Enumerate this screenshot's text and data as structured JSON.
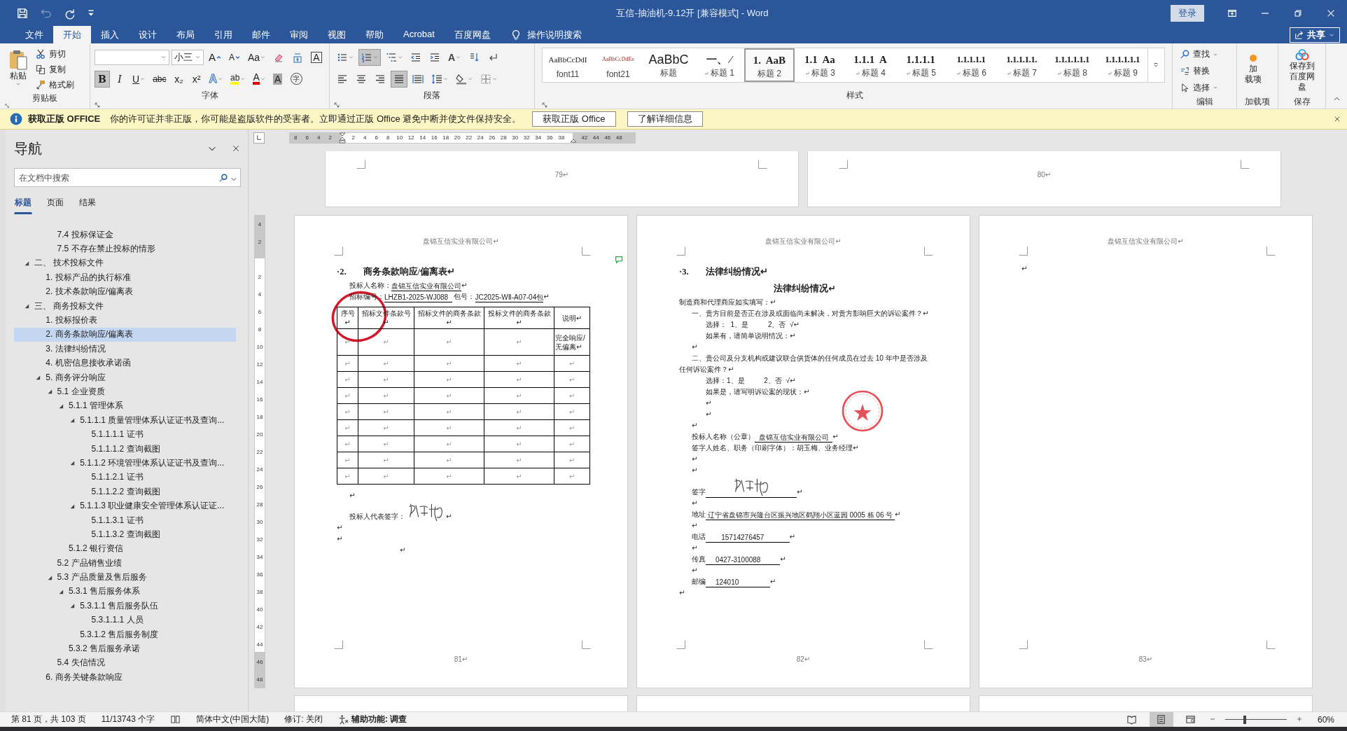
{
  "title_bar": {
    "quick_access": [
      {
        "kind": "save",
        "disabled": false
      },
      {
        "kind": "undo",
        "disabled": true
      },
      {
        "kind": "redo",
        "disabled": false
      },
      {
        "kind": "customize",
        "disabled": false
      }
    ],
    "title": "互信-抽油机-9.12开 [兼容模式]  -  Word",
    "sign_in": "登录",
    "controls": [
      {
        "kind": "ribbon_display"
      },
      {
        "kind": "minimize"
      },
      {
        "kind": "restore"
      },
      {
        "kind": "close"
      }
    ]
  },
  "tabs": [
    {
      "label": "文件",
      "selected": false
    },
    {
      "label": "开始",
      "selected": true
    },
    {
      "label": "插入",
      "selected": false
    },
    {
      "label": "设计",
      "selected": false
    },
    {
      "label": "布局",
      "selected": false
    },
    {
      "label": "引用",
      "selected": false
    },
    {
      "label": "邮件",
      "selected": false
    },
    {
      "label": "审阅",
      "selected": false
    },
    {
      "label": "视图",
      "selected": false
    },
    {
      "label": "帮助",
      "selected": false
    },
    {
      "label": "Acrobat",
      "selected": false
    },
    {
      "label": "百度网盘",
      "selected": false
    }
  ],
  "tell_me": "操作说明搜索",
  "share": "共享",
  "ribbon": {
    "clipboard": {
      "label": "剪贴板",
      "paste": "粘贴",
      "items": [
        {
          "kind": "cut",
          "label": "剪切"
        },
        {
          "kind": "copy",
          "label": "复制"
        },
        {
          "kind": "painter",
          "label": "格式刷"
        }
      ]
    },
    "font": {
      "label": "字体",
      "font_size": "小三",
      "row1": [
        {
          "kind": "grow",
          "text": "A"
        },
        {
          "kind": "shrink",
          "text": "A"
        },
        {
          "kind": "case",
          "text": "Aa"
        },
        {
          "kind": "clear"
        },
        {
          "kind": "phonetic"
        },
        {
          "kind": "border",
          "text": "A"
        }
      ],
      "row2": [
        {
          "kind": "bold",
          "text": "B",
          "selected": true
        },
        {
          "kind": "italic",
          "text": "I",
          "selected": false
        },
        {
          "kind": "underline",
          "text": "U",
          "selected": false
        },
        {
          "kind": "strike",
          "text": "abc",
          "selected": false
        },
        {
          "kind": "sub",
          "text": "x₂",
          "selected": false
        },
        {
          "kind": "sup",
          "text": "x²",
          "selected": false
        },
        {
          "kind": "effects",
          "text": "A"
        },
        {
          "kind": "highlight",
          "text": "ab"
        },
        {
          "kind": "font_color",
          "text": "A"
        },
        {
          "kind": "shading",
          "text": "A",
          "selected": false
        },
        {
          "kind": "enclose",
          "text": "字"
        }
      ]
    },
    "paragraph": {
      "label": "段落",
      "row1": [
        {
          "kind": "bullets",
          "selected": false
        },
        {
          "kind": "numbering",
          "selected": true
        },
        {
          "kind": "multilevel"
        },
        {
          "kind": "outdent"
        },
        {
          "kind": "indent"
        },
        {
          "kind": "asian",
          "text": "A"
        },
        {
          "kind": "sort"
        },
        {
          "kind": "marks",
          "selected": false
        }
      ],
      "row2": [
        {
          "kind": "align_left",
          "selected": false
        },
        {
          "kind": "align_center",
          "selected": false
        },
        {
          "kind": "align_right",
          "selected": false
        },
        {
          "kind": "justify",
          "selected": true
        },
        {
          "kind": "distribute",
          "selected": false
        },
        {
          "kind": "line_spacing"
        },
        {
          "kind": "para_shading"
        },
        {
          "kind": "borders"
        }
      ]
    },
    "styles": {
      "label": "样式",
      "items": [
        {
          "kind": "body",
          "preview": "AaBbCcDdI",
          "name": "font11",
          "mark": false,
          "selected": false
        },
        {
          "kind": "small",
          "preview": "AaBbCcDdEe",
          "name": "font21",
          "mark": false,
          "selected": false
        },
        {
          "kind": "title",
          "preview": "AaBbC",
          "name": "标题",
          "mark": false,
          "selected": false
        },
        {
          "kind": "heading",
          "preview": "一、 ⁄",
          "name": "标题 1",
          "mark": true,
          "selected": false
        },
        {
          "kind": "heading",
          "preview": "1.  AaB",
          "name": "标题 2",
          "mark": false,
          "selected": true
        },
        {
          "kind": "heading",
          "preview": "1.1  Aa",
          "name": "标题 3",
          "mark": true,
          "selected": false
        },
        {
          "kind": "heading",
          "preview": "1.1.1  A",
          "name": "标题 4",
          "mark": true,
          "selected": false
        },
        {
          "kind": "heading",
          "preview": "1.1.1.1",
          "name": "标题 5",
          "mark": true,
          "selected": false
        },
        {
          "kind": "minor",
          "preview": "1.1.1.1.1",
          "name": "标题 6",
          "mark": true,
          "selected": false
        },
        {
          "kind": "minor",
          "preview": "1.1.1.1.1.",
          "name": "标题 7",
          "mark": true,
          "selected": false
        },
        {
          "kind": "minor",
          "preview": "1.1.1.1.1.1",
          "name": "标题 8",
          "mark": true,
          "selected": false
        },
        {
          "kind": "minor",
          "preview": "1.1.1.1.1.1",
          "name": "标题 9",
          "mark": true,
          "selected": false
        }
      ]
    },
    "editing": {
      "label": "编辑",
      "items": [
        {
          "kind": "find",
          "label": "查找"
        },
        {
          "kind": "replace",
          "label": "替换"
        },
        {
          "kind": "select",
          "label": "选择"
        }
      ]
    },
    "addins": {
      "label": "加载项",
      "button_lines": [
        "加",
        "载项"
      ]
    },
    "save": {
      "label": "保存",
      "button_lines": [
        "保存到",
        "百度网盘"
      ]
    }
  },
  "message_bar": {
    "title": "获取正版 OFFICE",
    "text": "你的许可证并非正版，你可能是盗版软件的受害者。立即通过正版 Office 避免中断并使文件保持安全。",
    "buttons": [
      "获取正版 Office",
      "了解详细信息"
    ]
  },
  "nav": {
    "title": "导航",
    "search_placeholder": "在文档中搜索",
    "tabs": [
      {
        "label": "标题",
        "selected": true
      },
      {
        "label": "页面",
        "selected": false
      },
      {
        "label": "结果",
        "selected": false
      }
    ],
    "continued": [
      {
        "label": "7.4 投标保证金",
        "selected": false
      },
      {
        "label": "7.5 不存在禁止投标的情形",
        "selected": false
      }
    ],
    "outline": [
      {
        "label": "二、 技术投标文件",
        "expanded": true,
        "selected": false,
        "children": [
          {
            "label": "1. 投标产品的执行标准",
            "selected": false
          },
          {
            "label": "2. 技术条款响应/偏离表",
            "selected": false
          }
        ]
      },
      {
        "label": "三、 商务投标文件",
        "expanded": true,
        "selected": false,
        "children": [
          {
            "label": "1. 投标报价表",
            "selected": false
          },
          {
            "label": "2. 商务条款响应/偏离表",
            "selected": true
          },
          {
            "label": "3. 法律纠纷情况",
            "selected": false
          },
          {
            "label": "4. 机密信息接收承诺函",
            "selected": false
          },
          {
            "label": "5. 商务评分响应",
            "expanded": true,
            "selected": false,
            "children": [
              {
                "label": "5.1 企业资质",
                "expanded": true,
                "selected": false,
                "children": [
                  {
                    "label": "5.1.1 管理体系",
                    "expanded": true,
                    "selected": false,
                    "children": [
                      {
                        "label": "5.1.1.1 质量管理体系认证证书及查询...",
                        "expanded": true,
                        "selected": false,
                        "children": [
                          {
                            "label": "5.1.1.1.1 证书",
                            "selected": false
                          },
                          {
                            "label": "5.1.1.1.2 查询截图",
                            "selected": false
                          }
                        ]
                      },
                      {
                        "label": "5.1.1.2 环境管理体系认证证书及查询...",
                        "expanded": true,
                        "selected": false,
                        "children": [
                          {
                            "label": "5.1.1.2.1 证书",
                            "selected": false
                          },
                          {
                            "label": "5.1.1.2.2 查询截图",
                            "selected": false
                          }
                        ]
                      },
                      {
                        "label": "5.1.1.3 职业健康安全管理体系认证证...",
                        "expanded": true,
                        "selected": false,
                        "children": [
                          {
                            "label": "5.1.1.3.1 证书",
                            "selected": false
                          },
                          {
                            "label": "5.1.1.3.2 查询截图",
                            "selected": false
                          }
                        ]
                      }
                    ]
                  },
                  {
                    "label": "5.1.2 银行资信",
                    "selected": false
                  }
                ]
              },
              {
                "label": "5.2 产品销售业绩",
                "selected": false
              },
              {
                "label": "5.3 产品质量及售后服务",
                "expanded": true,
                "selected": false,
                "children": [
                  {
                    "label": "5.3.1 售后服务体系",
                    "expanded": true,
                    "selected": false,
                    "children": [
                      {
                        "label": "5.3.1.1 售后服务队伍",
                        "expanded": true,
                        "selected": false,
                        "children": [
                          {
                            "label": "5.3.1.1.1 人员",
                            "selected": false
                          }
                        ]
                      },
                      {
                        "label": "5.3.1.2 售后服务制度",
                        "selected": false
                      }
                    ]
                  },
                  {
                    "label": "5.3.2 售后服务承诺",
                    "selected": false
                  }
                ]
              },
              {
                "label": "5.4 失信情况",
                "selected": false
              }
            ]
          },
          {
            "label": "6. 商务关键条款响应",
            "selected": false
          }
        ]
      }
    ]
  },
  "document": {
    "hruler": [
      "8",
      "6",
      "4",
      "2",
      "2",
      "4",
      "6",
      "8",
      "10",
      "12",
      "14",
      "16",
      "18",
      "20",
      "22",
      "24",
      "26",
      "28",
      "30",
      "32",
      "34",
      "36",
      "38",
      "42",
      "44",
      "46",
      "48"
    ],
    "vruler": [
      "4",
      "2",
      "2",
      "4",
      "6",
      "8",
      "10",
      "12",
      "14",
      "16",
      "18",
      "20",
      "22",
      "24",
      "26",
      "28",
      "30",
      "32",
      "34",
      "36",
      "38",
      "40",
      "42",
      "44",
      "46",
      "48"
    ],
    "pages_above": [
      {
        "number": "79↵"
      },
      {
        "number": "80↵"
      }
    ],
    "pages": [
      {
        "header": "盘锦互信实业有限公司↵",
        "number": "81↵",
        "markup": [
          {
            "kind": "ink_circle"
          },
          {
            "kind": "comment"
          }
        ],
        "blocks": [
          {
            "kind": "heading",
            "num": "·2.",
            "text": "商务条款响应/偏离表↵"
          },
          {
            "kind": "fields",
            "parts": [
              {
                "kind": "text",
                "text": "投标人名称：",
                "underline": false
              },
              {
                "kind": "text",
                "text": "盘锦互信实业有限公司",
                "underline": true
              },
              {
                "kind": "text",
                "text": "↵",
                "underline": false
              }
            ]
          },
          {
            "kind": "fields",
            "parts": [
              {
                "kind": "text",
                "text": "招标编号：",
                "underline": false
              },
              {
                "kind": "text",
                "text": "LHZB1-2025-WJ088  ",
                "underline": true
              },
              {
                "kind": "text",
                "text": " 包号：",
                "underline": false
              },
              {
                "kind": "text",
                "text": "JC2025-WⅡ-A07-04包",
                "underline": true
              },
              {
                "kind": "text",
                "text": "↵",
                "underline": false
              }
            ]
          },
          {
            "kind": "table",
            "columns": [
              "序号↵",
              "招标文件条款号↵",
              "招标文件的商务条款↵",
              "投标文件的商务条款↵",
              "说明↵"
            ],
            "rows": [
              [
                "↵",
                "↵",
                "↵",
                "↵",
                "完全响应/无偏离↵"
              ],
              [
                "↵",
                "↵",
                "↵",
                "↵",
                "↵"
              ],
              [
                "↵",
                "↵",
                "↵",
                "↵",
                "↵"
              ],
              [
                "↵",
                "↵",
                "↵",
                "↵",
                "↵"
              ],
              [
                "↵",
                "↵",
                "↵",
                "↵",
                "↵"
              ],
              [
                "↵",
                "↵",
                "↵",
                "↵",
                "↵"
              ],
              [
                "↵",
                "↵",
                "↵",
                "↵",
                "↵"
              ],
              [
                "↵",
                "↵",
                "↵",
                "↵",
                "↵"
              ],
              [
                "↵",
                "↵",
                "↵",
                "↵",
                "↵"
              ]
            ]
          },
          {
            "kind": "para1",
            "text": "↵"
          },
          {
            "kind": "fields",
            "parts": [
              {
                "kind": "text",
                "text": "投标人代表签字：",
                "underline": false
              },
              {
                "kind": "signature",
                "underline": false
              },
              {
                "kind": "text",
                "text": "↵",
                "underline": false
              }
            ]
          },
          {
            "kind": "para",
            "text": "↵"
          },
          {
            "kind": "para",
            "text": "↵"
          },
          {
            "kind": "center",
            "text": "↵"
          }
        ]
      },
      {
        "header": "盘锦互信实业有限公司↵",
        "number": "82↵",
        "markup": [
          {
            "kind": "seal"
          }
        ],
        "blocks": [
          {
            "kind": "heading",
            "num": "·3.",
            "text": "法律纠纷情况↵"
          },
          {
            "kind": "title",
            "text": "法律纠纷情况↵"
          },
          {
            "kind": "para",
            "text": "制造商和代理商应如实填写：↵"
          },
          {
            "kind": "para1",
            "text": "一、贵方目前是否正在涉及或面临尚未解决，对贵方影响巨大的诉讼案件？↵"
          },
          {
            "kind": "para2",
            "text": "选择：  1、是          2、否  √↵"
          },
          {
            "kind": "para2",
            "text": "如果有，请简单说明情况：↵"
          },
          {
            "kind": "para1",
            "text": "↵"
          },
          {
            "kind": "first_indent",
            "text": "二、贵公司及分支机构或建议联合供货体的任何成员在过去 10 年中是否涉及任何诉讼案件？↵"
          },
          {
            "kind": "para2",
            "text": "选择：1、是          2、否  √↵"
          },
          {
            "kind": "para2",
            "text": "如果是，请写明诉讼案的现状：↵"
          },
          {
            "kind": "para2",
            "text": "↵"
          },
          {
            "kind": "para2",
            "text": "↵"
          },
          {
            "kind": "para1",
            "text": "↵"
          },
          {
            "kind": "fields",
            "parts": [
              {
                "kind": "text",
                "text": "投标人名称（公章）",
                "underline": false
              },
              {
                "kind": "text",
                "text": "  盘锦互信实业有限公司  ",
                "underline": true
              },
              {
                "kind": "text",
                "text": "↵",
                "underline": false
              }
            ]
          },
          {
            "kind": "fields",
            "parts": [
              {
                "kind": "text",
                "text": "签字人姓名、职务（印刷字体）：胡玉梅、业务经理↵",
                "underline": false
              }
            ]
          },
          {
            "kind": "para1",
            "text": "↵"
          },
          {
            "kind": "para1",
            "text": "↵"
          },
          {
            "kind": "fields",
            "parts": [
              {
                "kind": "text",
                "text": "签字",
                "underline": false
              },
              {
                "kind": "signature",
                "underline": true
              },
              {
                "kind": "text",
                "text": "↵",
                "underline": false
              }
            ]
          },
          {
            "kind": "para1",
            "text": "↵"
          },
          {
            "kind": "fields",
            "parts": [
              {
                "kind": "text",
                "text": "地址",
                "underline": false
              },
              {
                "kind": "text",
                "text": " 辽宁省盘锦市兴隆台区振兴地区鹤翔小区蓝园 0005 栋 06 号 ",
                "underline": true
              },
              {
                "kind": "text",
                "text": "↵",
                "underline": false
              }
            ]
          },
          {
            "kind": "para1",
            "text": "↵"
          },
          {
            "kind": "fields",
            "parts": [
              {
                "kind": "text",
                "text": "电话",
                "underline": false
              },
              {
                "kind": "text",
                "text": "        15714276457             ",
                "underline": true
              },
              {
                "kind": "text",
                "text": "↵",
                "underline": false
              }
            ]
          },
          {
            "kind": "para1",
            "text": "↵"
          },
          {
            "kind": "fields",
            "parts": [
              {
                "kind": "text",
                "text": "传真",
                "underline": false
              },
              {
                "kind": "text",
                "text": "     0427-3100088          ",
                "underline": true
              },
              {
                "kind": "text",
                "text": "↵",
                "underline": false
              }
            ]
          },
          {
            "kind": "para1",
            "text": "↵"
          },
          {
            "kind": "fields",
            "parts": [
              {
                "kind": "text",
                "text": "邮编",
                "underline": false
              },
              {
                "kind": "text",
                "text": "     124010                ",
                "underline": true
              },
              {
                "kind": "text",
                "text": "↵",
                "underline": false
              }
            ]
          },
          {
            "kind": "para",
            "text": "↵"
          }
        ]
      },
      {
        "header": "盘锦互信实业有限公司↵",
        "number": "83↵",
        "blocks": [
          {
            "kind": "para",
            "text": "↵"
          }
        ]
      }
    ]
  },
  "status_bar": {
    "page": "第 81 页，共 103 页",
    "words": "11/13743 个字",
    "language": "简体中文(中国大陆)",
    "track_changes": "修订: 关闭",
    "accessibility": "辅助功能: 调查",
    "views": [
      {
        "kind": "read",
        "selected": false
      },
      {
        "kind": "print",
        "selected": true
      },
      {
        "kind": "web",
        "selected": false
      }
    ],
    "zoom": {
      "level": 0.3,
      "reading": "60%"
    }
  }
}
